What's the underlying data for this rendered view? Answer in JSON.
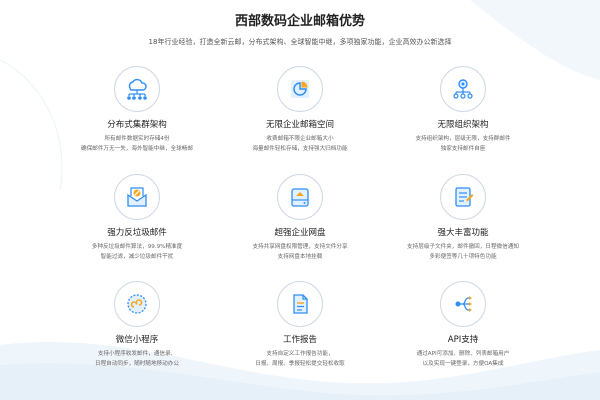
{
  "header": {
    "title": "西部数码企业邮箱优势",
    "subtitle": "18年行业经验，打造全新云邮，分布式架构、全球智能中继，多项独家功能，企业高效办公新选择"
  },
  "features": [
    {
      "icon": "cluster-icon",
      "title": "分布式集群架构",
      "desc1": "所有邮件数据实时存储4份",
      "desc2": "确保邮件万无一失，海外智能中继，全球畅邮"
    },
    {
      "icon": "pie-chart-icon",
      "title": "无限企业邮箱空间",
      "desc1": "收费邮箱不限企业邮箱大小",
      "desc2": "海量邮件轻松存储，支持强大归档功能"
    },
    {
      "icon": "org-structure-icon",
      "title": "无限组织架构",
      "desc1": "支持组织架构，层级无限，支持群邮件",
      "desc2": "独家支持邮件自座"
    },
    {
      "icon": "spam-shield-icon",
      "title": "强力反垃圾邮件",
      "desc1": "多种反垃圾邮件算法，99.9%精准度",
      "desc2": "智能过滤，减少垃圾邮件干扰"
    },
    {
      "icon": "disk-icon",
      "title": "超强企业网盘",
      "desc1": "支持共享网盘权限管理，支持文件分享",
      "desc2": "支持网盘本地挂载"
    },
    {
      "icon": "feature-list-icon",
      "title": "强大丰富功能",
      "desc1": "支持层级子文件夹，邮件撤回，日程微信通知",
      "desc2": "多彩便签等几十项特色功能"
    },
    {
      "icon": "mini-program-icon",
      "title": "微信小程序",
      "desc1": "支持小程序收发邮件，通信录、",
      "desc2": "日程自动同步，随时随地移动办公"
    },
    {
      "icon": "report-icon",
      "title": "工作报告",
      "desc1": "支持自定义工作报告功能，",
      "desc2": "日报、周报、季报轻松提交轻松收取"
    },
    {
      "icon": "api-icon",
      "title": "API支持",
      "desc1": "通过API可添加、删除、列表邮箱用户",
      "desc2": "以及实现一键登录，方便OA集成"
    }
  ],
  "colors": {
    "accent": "#2f8ef4",
    "accent_light": "#e3f0ff",
    "circle_border": "#cfd8e4"
  }
}
